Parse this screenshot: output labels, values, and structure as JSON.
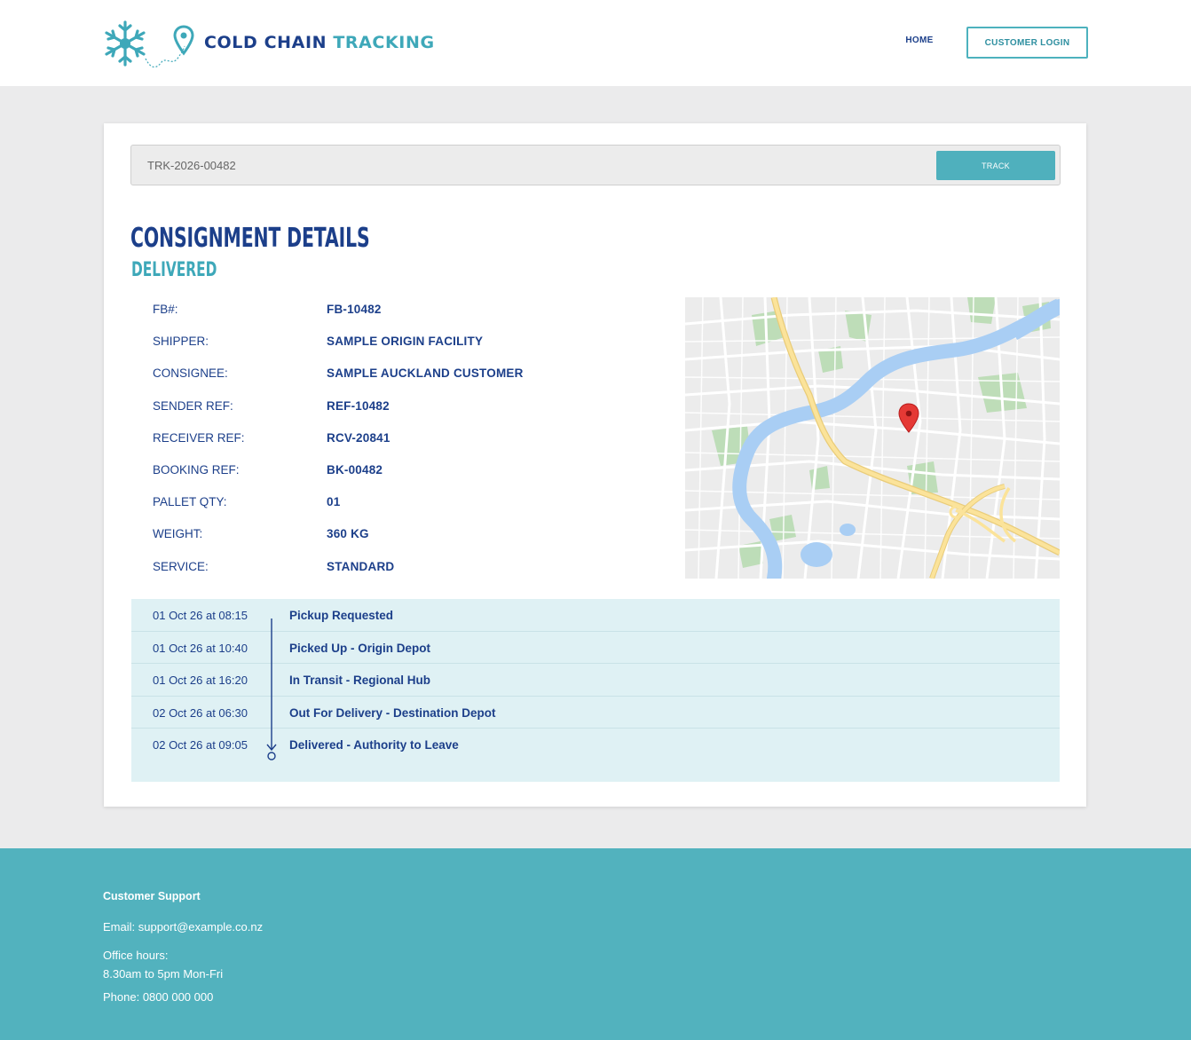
{
  "header": {
    "brand_word1": "COLD CHAIN",
    "brand_word2": "TRACKING",
    "nav_home": "HOME",
    "nav_login": "CUSTOMER LOGIN"
  },
  "search": {
    "value": "TRK-2026-00482",
    "button_label": "TRACK"
  },
  "consignment": {
    "title": "CONSIGNMENT DETAILS",
    "status": "DELIVERED",
    "fields": [
      {
        "label": "FB#:",
        "value": "FB-10482"
      },
      {
        "label": "SHIPPER:",
        "value": "SAMPLE ORIGIN FACILITY"
      },
      {
        "label": "CONSIGNEE:",
        "value": "SAMPLE AUCKLAND CUSTOMER"
      },
      {
        "label": "SENDER REF:",
        "value": "REF-10482"
      },
      {
        "label": "RECEIVER REF:",
        "value": "RCV-20841"
      },
      {
        "label": "BOOKING REF:",
        "value": "BK-00482"
      },
      {
        "label": "PALLET QTY:",
        "value": "01"
      },
      {
        "label": "WEIGHT:",
        "value": "360 KG"
      },
      {
        "label": "SERVICE:",
        "value": "STANDARD"
      }
    ]
  },
  "timeline": [
    {
      "date": "01 Oct 26 at 08:15",
      "event": "Pickup Requested"
    },
    {
      "date": "01 Oct 26 at 10:40",
      "event": "Picked Up - Origin Depot"
    },
    {
      "date": "01 Oct 26 at 16:20",
      "event": "In Transit - Regional Hub"
    },
    {
      "date": "02 Oct 26 at 06:30",
      "event": "Out For Delivery - Destination Depot"
    },
    {
      "date": "02 Oct 26 at 09:05",
      "event": "Delivered - Authority to Leave"
    }
  ],
  "footer": {
    "title": "Customer Support",
    "email": "Email: support@example.co.nz",
    "hours_label": "Office hours:",
    "hours_value": "8.30am to 5pm Mon-Fri",
    "phone": "Phone: 0800 000 000"
  },
  "icons": {
    "logo": "snowflake-icon",
    "location": "location-pin-icon",
    "map_marker": "map-marker-icon",
    "timeline_arrow": "timeline-arrow-icon"
  },
  "colors": {
    "navy": "#1c3f8a",
    "teal": "#3ea8b9",
    "button": "#4fb0bd",
    "footer": "#52b2be",
    "timeline_bg": "#dff1f4"
  }
}
